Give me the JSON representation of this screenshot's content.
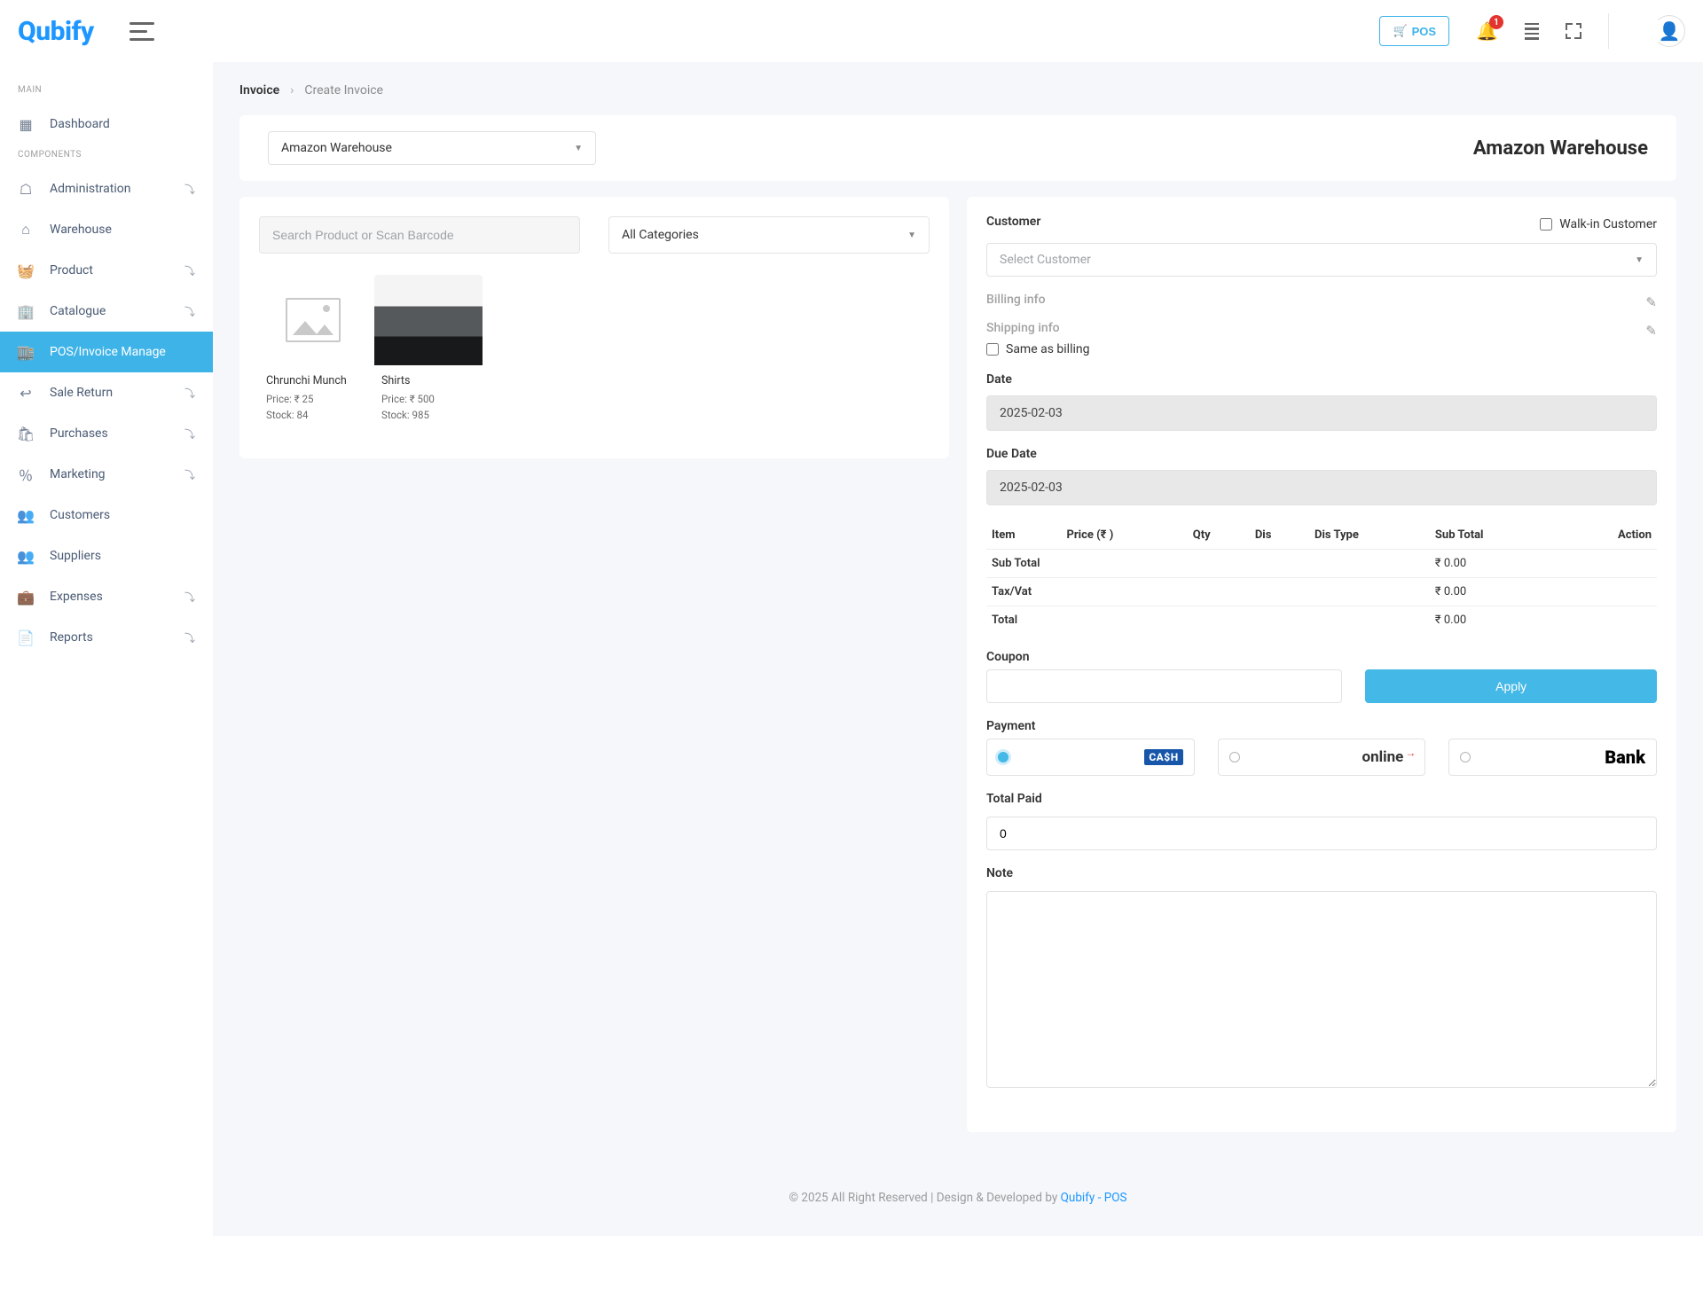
{
  "brand": "Qubify",
  "topbar": {
    "pos_label": "POS",
    "notif_count": "1"
  },
  "sidebar": {
    "section_main": "MAIN",
    "section_components": "COMPONENTS",
    "items": [
      {
        "label": "Dashboard",
        "chev": false
      },
      {
        "label": "Administration",
        "chev": true
      },
      {
        "label": "Warehouse",
        "chev": false
      },
      {
        "label": "Product",
        "chev": true
      },
      {
        "label": "Catalogue",
        "chev": true
      },
      {
        "label": "POS/Invoice Manage",
        "chev": false,
        "active": true
      },
      {
        "label": "Sale Return",
        "chev": true
      },
      {
        "label": "Purchases",
        "chev": true
      },
      {
        "label": "Marketing",
        "chev": true
      },
      {
        "label": "Customers",
        "chev": false
      },
      {
        "label": "Suppliers",
        "chev": false
      },
      {
        "label": "Expenses",
        "chev": true
      },
      {
        "label": "Reports",
        "chev": true
      }
    ]
  },
  "breadcrumb": {
    "root": "Invoice",
    "current": "Create Invoice"
  },
  "warehouse": {
    "selected": "Amazon Warehouse",
    "title": "Amazon Warehouse"
  },
  "filters": {
    "search_placeholder": "Search Product or Scan Barcode",
    "category_label": "All Categories"
  },
  "products": [
    {
      "name": "Chrunchi Munch",
      "price_label": "Price: ₹ 25",
      "stock_label": "Stock: 84",
      "image": "placeholder"
    },
    {
      "name": "Shirts",
      "price_label": "Price: ₹ 500",
      "stock_label": "Stock: 985",
      "image": "shirt"
    }
  ],
  "form": {
    "customer_label": "Customer",
    "walkin_label": "Walk-in Customer",
    "select_customer_placeholder": "Select Customer",
    "billing_label": "Billing info",
    "shipping_label": "Shipping info",
    "same_as_billing": "Same as billing",
    "date_label": "Date",
    "date_value": "2025-02-03",
    "due_label": "Due Date",
    "due_value": "2025-02-03",
    "coupon_label": "Coupon",
    "apply_label": "Apply",
    "payment_label": "Payment",
    "total_paid_label": "Total Paid",
    "total_paid_value": "0",
    "note_label": "Note",
    "pay_cash": "CA$H",
    "pay_online": "online",
    "pay_bank": "Bank"
  },
  "table": {
    "headers": [
      "Item",
      "Price (₹ )",
      "Qty",
      "Dis",
      "Dis Type",
      "Sub Total",
      "Action"
    ],
    "summary": [
      {
        "label": "Sub Total",
        "value": "₹ 0.00"
      },
      {
        "label": "Tax/Vat",
        "value": "₹ 0.00"
      },
      {
        "label": "Total",
        "value": "₹ 0.00"
      }
    ]
  },
  "footer": {
    "text": "© 2025 All Right Reserved | Design & Developed by ",
    "link": "Qubify - POS"
  }
}
